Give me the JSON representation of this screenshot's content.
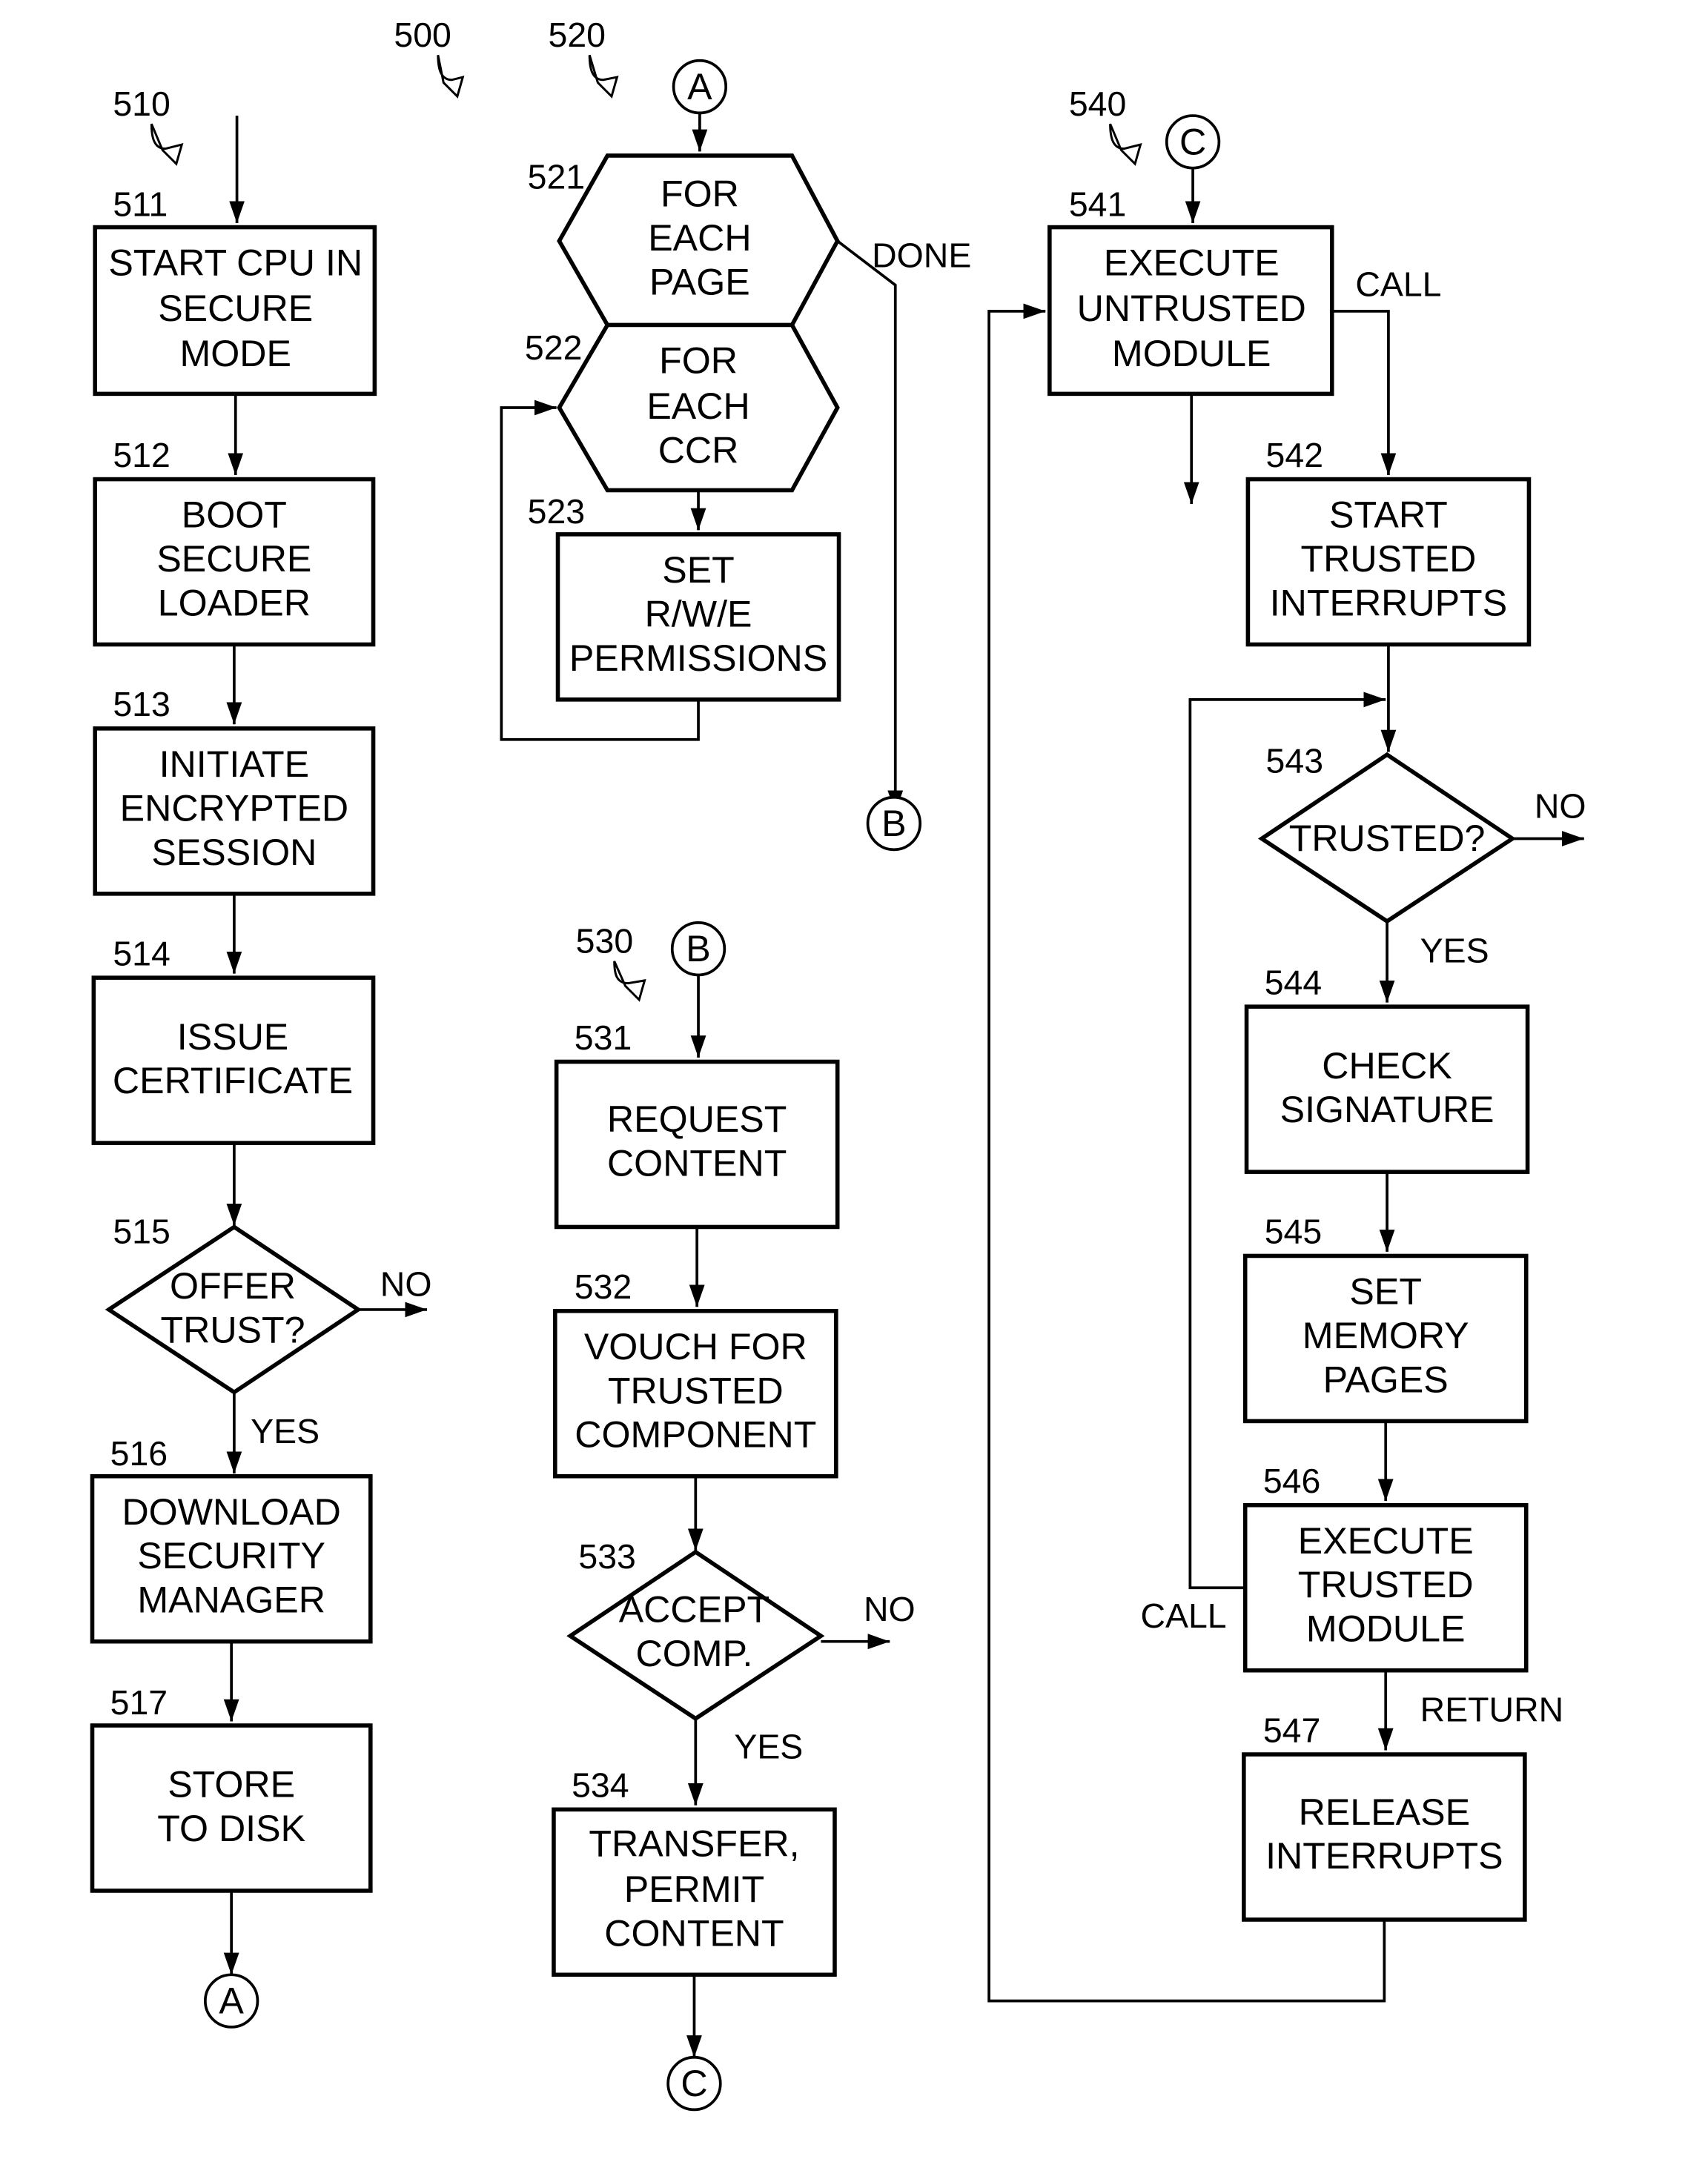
{
  "figure": {
    "ref": "500",
    "flows": [
      {
        "ref": "510"
      },
      {
        "ref": "520"
      },
      {
        "ref": "530"
      },
      {
        "ref": "540"
      }
    ]
  },
  "nodes": {
    "n511": {
      "ref": "511",
      "lines": [
        "START CPU IN",
        "SECURE",
        "MODE"
      ]
    },
    "n512": {
      "ref": "512",
      "lines": [
        "BOOT",
        "SECURE",
        "LOADER"
      ]
    },
    "n513": {
      "ref": "513",
      "lines": [
        "INITIATE",
        "ENCRYPTED",
        "SESSION"
      ]
    },
    "n514": {
      "ref": "514",
      "lines": [
        "ISSUE",
        "CERTIFICATE"
      ]
    },
    "n515": {
      "ref": "515",
      "lines": [
        "OFFER",
        "TRUST?"
      ]
    },
    "n516": {
      "ref": "516",
      "lines": [
        "DOWNLOAD",
        "SECURITY",
        "MANAGER"
      ]
    },
    "n517": {
      "ref": "517",
      "lines": [
        "STORE",
        "TO DISK"
      ]
    },
    "n521": {
      "ref": "521",
      "lines": [
        "FOR",
        "EACH",
        "PAGE"
      ]
    },
    "n522": {
      "ref": "522",
      "lines": [
        "FOR",
        "EACH",
        "CCR"
      ]
    },
    "n523": {
      "ref": "523",
      "lines": [
        "SET",
        "R/W/E",
        "PERMISSIONS"
      ]
    },
    "n531": {
      "ref": "531",
      "lines": [
        "REQUEST",
        "CONTENT"
      ]
    },
    "n532": {
      "ref": "532",
      "lines": [
        "VOUCH FOR",
        "TRUSTED",
        "COMPONENT"
      ]
    },
    "n533": {
      "ref": "533",
      "lines": [
        "ACCEPT",
        "COMP."
      ]
    },
    "n534": {
      "ref": "534",
      "lines": [
        "TRANSFER,",
        "PERMIT",
        "CONTENT"
      ]
    },
    "n541": {
      "ref": "541",
      "lines": [
        "EXECUTE",
        "UNTRUSTED",
        "MODULE"
      ]
    },
    "n542": {
      "ref": "542",
      "lines": [
        "START",
        "TRUSTED",
        "INTERRUPTS"
      ]
    },
    "n543": {
      "ref": "543",
      "lines": [
        "TRUSTED?"
      ]
    },
    "n544": {
      "ref": "544",
      "lines": [
        "CHECK",
        "SIGNATURE"
      ]
    },
    "n545": {
      "ref": "545",
      "lines": [
        "SET",
        "MEMORY",
        "PAGES"
      ]
    },
    "n546": {
      "ref": "546",
      "lines": [
        "EXECUTE",
        "TRUSTED",
        "MODULE"
      ]
    },
    "n547": {
      "ref": "547",
      "lines": [
        "RELEASE",
        "INTERRUPTS"
      ]
    }
  },
  "connectors": {
    "A_out": "A",
    "A_in": "A",
    "B_out": "B",
    "B_in": "B",
    "C_out": "C",
    "C_in": "C"
  },
  "edge_labels": {
    "done": "DONE",
    "no_515": "NO",
    "yes_515": "YES",
    "no_533": "NO",
    "yes_533": "YES",
    "call_541": "CALL",
    "no_543": "NO",
    "yes_543": "YES",
    "call_546": "CALL",
    "return_546": "RETURN"
  }
}
